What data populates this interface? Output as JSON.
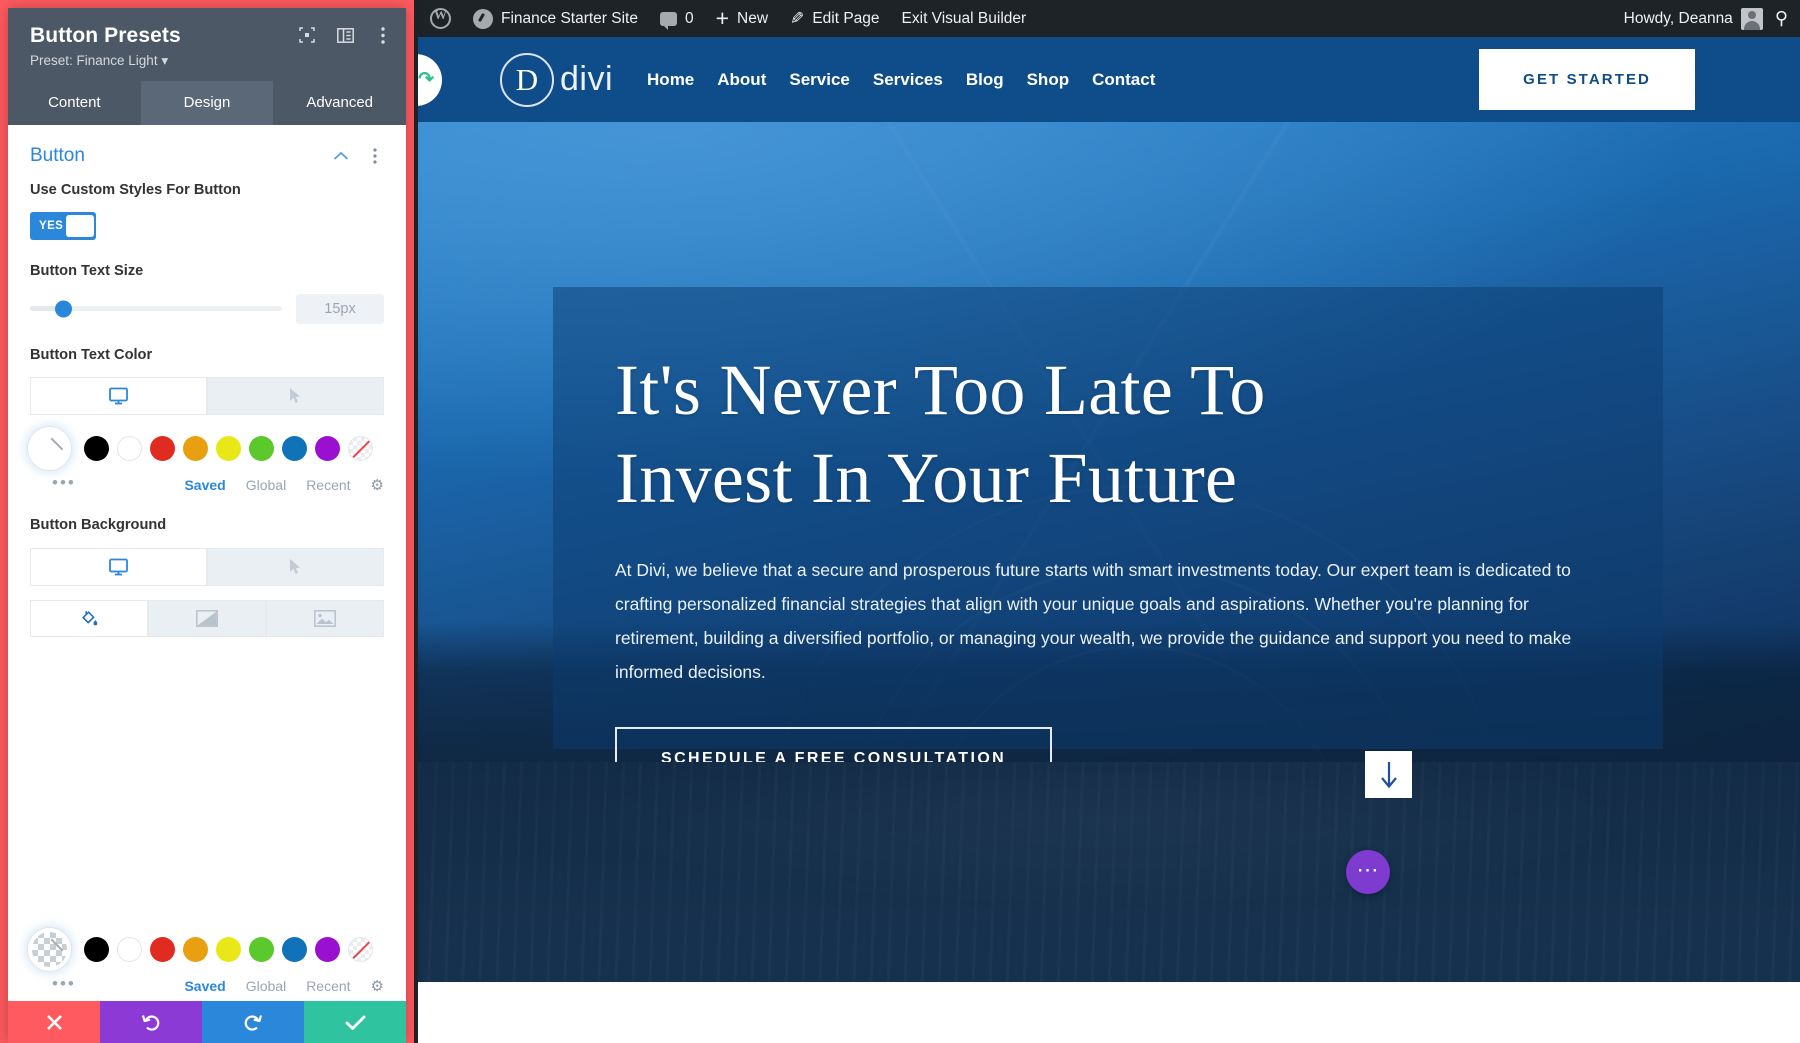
{
  "admin_bar": {
    "site_title": "Finance Starter Site",
    "comments_count": "0",
    "new_label": "New",
    "edit_page_label": "Edit Page",
    "exit_builder_label": "Exit Visual Builder",
    "howdy": "Howdy, Deanna",
    "wp_logo_icon": "wordpress-logo-icon",
    "site_icon": "site-dashboard-icon",
    "comment_icon": "comment-bubble-icon",
    "plus_icon": "plus-icon",
    "pencil_icon": "pencil-icon",
    "avatar_icon": "user-avatar-icon",
    "search_icon": "search-icon"
  },
  "site": {
    "logo_letter": "D",
    "logo_word": "divi",
    "nav": [
      {
        "label": "Home"
      },
      {
        "label": "About"
      },
      {
        "label": "Service"
      },
      {
        "label": "Services"
      },
      {
        "label": "Blog"
      },
      {
        "label": "Shop"
      },
      {
        "label": "Contact"
      }
    ],
    "cta_label": "GET STARTED",
    "divi_tab_icon": "divi-reload-icon"
  },
  "hero": {
    "title_line_1": "It's Never Too Late To",
    "title_line_2": "Invest In Your Future",
    "paragraph": "At Divi, we believe that a secure and prosperous future starts with smart investments today. Our expert team is dedicated to crafting personalized financial strategies that align with your unique goals and aspirations. Whether you're planning for retirement, building a diversified portfolio, or managing your wealth, we provide the guidance and support you need to make informed decisions.",
    "cta_label": "SCHEDULE A FREE CONSULTATION",
    "scroll_down_icon": "arrow-down-icon",
    "fab_icon": "ellipsis-icon"
  },
  "modal": {
    "title": "Button Presets",
    "subtitle": "Preset: Finance Light",
    "head_icons": {
      "fullscreen": "fullscreen-icon",
      "layout": "panel-layout-icon",
      "more": "vertical-ellipsis-icon"
    },
    "tabs": [
      {
        "label": "Content",
        "active": false
      },
      {
        "label": "Design",
        "active": true
      },
      {
        "label": "Advanced",
        "active": false
      }
    ],
    "section": {
      "title": "Button",
      "collapse_icon": "chevron-up-icon",
      "more_icon": "vertical-ellipsis-icon"
    },
    "fields": {
      "custom_styles_label": "Use Custom Styles For Button",
      "toggle_value": "YES",
      "text_size_label": "Button Text Size",
      "text_size_value": "15px",
      "text_color_label": "Button Text Color",
      "background_label": "Button Background"
    },
    "device_tabs": [
      {
        "icon": "desktop-icon",
        "active": true
      },
      {
        "icon": "cursor-hover-icon",
        "active": false
      }
    ],
    "bg_type_tabs": [
      {
        "icon": "paint-bucket-icon",
        "active": true
      },
      {
        "icon": "gradient-icon",
        "active": false
      },
      {
        "icon": "image-icon",
        "active": false
      }
    ],
    "palette": [
      {
        "name": "black",
        "hex": "#000000"
      },
      {
        "name": "white",
        "hex": "#ffffff"
      },
      {
        "name": "red",
        "hex": "#e02b20"
      },
      {
        "name": "orange",
        "hex": "#e8a011"
      },
      {
        "name": "yellow",
        "hex": "#e8e818"
      },
      {
        "name": "green",
        "hex": "#5bc92b"
      },
      {
        "name": "blue",
        "hex": "#1073b8"
      },
      {
        "name": "purple",
        "hex": "#9b0fd1"
      },
      {
        "name": "none",
        "hex": "transparent"
      }
    ],
    "palette_tabs": [
      {
        "label": "Saved",
        "active": true
      },
      {
        "label": "Global",
        "active": false
      },
      {
        "label": "Recent",
        "active": false
      }
    ],
    "palette_settings_icon": "gear-icon",
    "more_dots": "•••",
    "action_bar": {
      "close_icon": "close-icon",
      "undo_icon": "undo-icon",
      "redo_icon": "redo-icon",
      "save_icon": "check-icon"
    },
    "accent_color": "#2b87da",
    "outline_color": "#ff5a5f"
  }
}
